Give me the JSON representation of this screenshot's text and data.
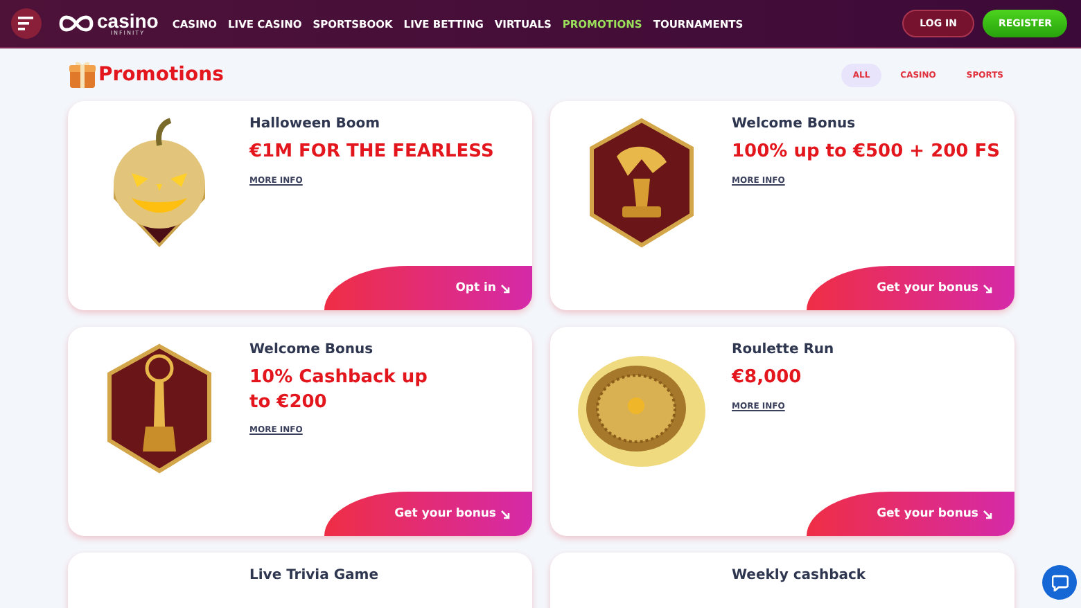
{
  "header": {
    "logo_text": "casino",
    "logo_subtext": "INFINITY",
    "nav": [
      {
        "label": "CASINO",
        "selected": false
      },
      {
        "label": "LIVE CASINO",
        "selected": false
      },
      {
        "label": "SPORTSBOOK",
        "selected": false
      },
      {
        "label": "LIVE BETTING",
        "selected": false
      },
      {
        "label": "VIRTUALS",
        "selected": false
      },
      {
        "label": "PROMOTIONS",
        "selected": true
      },
      {
        "label": "TOURNAMENTS",
        "selected": false
      }
    ],
    "login": "LOG IN",
    "register": "REGISTER"
  },
  "page_title": "Promotions",
  "filters": [
    {
      "label": "ALL",
      "selected": true
    },
    {
      "label": "CASINO",
      "selected": false
    },
    {
      "label": "SPORTS",
      "selected": false
    }
  ],
  "promotions": [
    {
      "title": "Halloween Boom",
      "headline": "€1M FOR THE FEARLESS",
      "more_info": "MORE INFO",
      "button": "Opt in"
    },
    {
      "title": "Welcome Bonus",
      "headline": "100% up to €500 + 200 FS",
      "more_info": "MORE INFO",
      "button": "Get your bonus"
    },
    {
      "title": "Welcome Bonus",
      "headline": "10% Cashback up\nto €200",
      "more_info": "MORE INFO",
      "button": "Get your bonus"
    },
    {
      "title": "Roulette Run",
      "headline": "€8,000",
      "more_info": "MORE INFO",
      "button": "Get your bonus"
    },
    {
      "title": "Live Trivia Game"
    },
    {
      "title": "Weekly cashback"
    }
  ]
}
